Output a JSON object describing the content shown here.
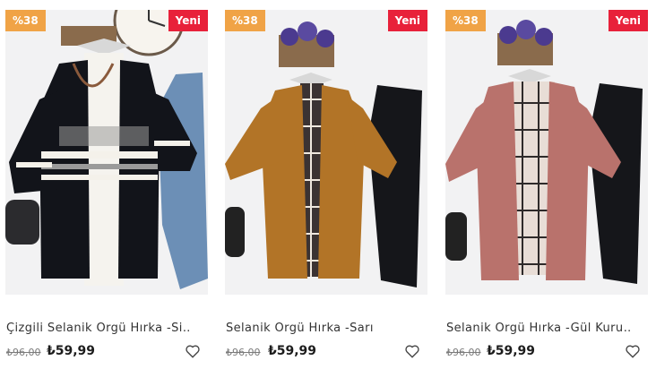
{
  "products": [
    {
      "title": "Çizgili Selanik Örgü Hırka -Si…",
      "discount_badge": "%38",
      "new_badge": "Yeni",
      "old_price": "₺96,00",
      "price": "₺59,99",
      "cardigan_color": "#12141a",
      "stripe_color": "#f4f1ea",
      "stripe2_color": "#9a9a9a",
      "inner_color": "#f5f3ee",
      "pants_color": "#6c8fb6"
    },
    {
      "title": "Selanik Örgü Hırka -Sarı",
      "discount_badge": "%38",
      "new_badge": "Yeni",
      "old_price": "₺96,00",
      "price": "₺59,99",
      "cardigan_color": "#b27427",
      "inner_color": "#3b3333",
      "pants_color": "#15161a"
    },
    {
      "title": "Selanik Örgü Hırka -Gül Kuru…",
      "discount_badge": "%38",
      "new_badge": "Yeni",
      "old_price": "₺96,00",
      "price": "₺59,99",
      "cardigan_color": "#b9726c",
      "inner_color": "#e8ddd6",
      "pants_color": "#15161a"
    }
  ],
  "colors": {
    "discount_badge_bg": "#f0a346",
    "new_badge_bg": "#e8213a"
  }
}
